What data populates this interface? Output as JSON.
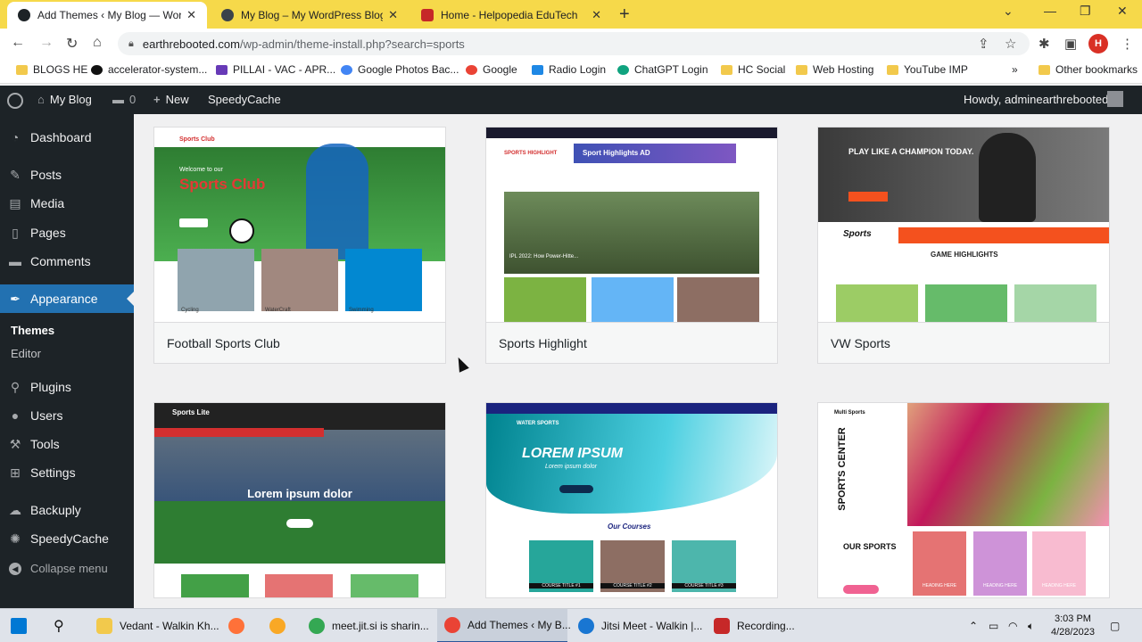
{
  "browser": {
    "tabs": [
      {
        "title": "Add Themes ‹ My Blog — WordPress",
        "active": true
      },
      {
        "title": "My Blog – My WordPress Blog"
      },
      {
        "title": "Home - Helpopedia EduTech"
      }
    ],
    "url": {
      "host": "earthrebooted.com",
      "path": "/wp-admin/theme-install.php?search=sports"
    },
    "profile_initial": "H",
    "bookmarks": [
      "BLOGS HE",
      "accelerator-system...",
      "PILLAI - VAC - APR...",
      "Google Photos Bac...",
      "Google",
      "Radio Login",
      "ChatGPT Login",
      "HC Social",
      "Web Hosting",
      "YouTube IMP",
      "Other bookmarks"
    ]
  },
  "adminbar": {
    "site": "My Blog",
    "comments": "0",
    "new": "New",
    "plugin": "SpeedyCache",
    "howdy": "Howdy, adminearthrebooted"
  },
  "sidebar": {
    "items": [
      {
        "label": "Dashboard",
        "icon": "dashboard-icon"
      },
      {
        "label": "Posts",
        "icon": "pin-icon"
      },
      {
        "label": "Media",
        "icon": "media-icon"
      },
      {
        "label": "Pages",
        "icon": "page-icon"
      },
      {
        "label": "Comments",
        "icon": "comment-icon"
      },
      {
        "label": "Appearance",
        "icon": "brush-icon"
      },
      {
        "label": "Plugins",
        "icon": "plugin-icon"
      },
      {
        "label": "Users",
        "icon": "user-icon"
      },
      {
        "label": "Tools",
        "icon": "wrench-icon"
      },
      {
        "label": "Settings",
        "icon": "settings-icon"
      },
      {
        "label": "Backuply",
        "icon": "cloud-icon"
      },
      {
        "label": "SpeedyCache",
        "icon": "speed-icon"
      }
    ],
    "sub": [
      "Themes",
      "Editor"
    ],
    "collapse": "Collapse menu"
  },
  "themes": [
    {
      "name": "Football Sports Club",
      "shot_brand": "Sports Club",
      "shot_headline": "Sports Club",
      "shot_welcome": "Welcome to our",
      "shot_captions": [
        "Cycling",
        "WaterCraft",
        "Swimming"
      ]
    },
    {
      "name": "Sports Highlight",
      "shot_brand": "SPORTS HIGHLIGHT",
      "shot_headline": "Sport Highlights AD",
      "shot_captions": [
        "IPL 2022: How Power-Hitte..."
      ]
    },
    {
      "name": "VW Sports",
      "shot_brand": "Sports",
      "shot_headline": "PLAY LIKE A CHAMPION TODAY.",
      "shot_captions": [
        "GAME HIGHLIGHTS"
      ]
    },
    {
      "name": "",
      "shot_brand": "Sports Lite",
      "shot_headline": "Lorem ipsum dolor",
      "shot_captions": []
    },
    {
      "name": "",
      "shot_brand": "WATER SPORTS",
      "shot_headline": "LOREM IPSUM",
      "shot_captions": [
        "Lorem ipsum dolor",
        "Our Courses",
        "COURSE TITLE #1",
        "COURSE TITLE #2",
        "COURSE TITLE #3"
      ]
    },
    {
      "name": "",
      "shot_brand": "Multi Sports",
      "shot_headline": "SPORTS CENTER",
      "shot_captions": [
        "OUR SPORTS",
        "HEADING HERE",
        "HEADING HERE",
        "HEADING HERE"
      ]
    }
  ],
  "taskbar": {
    "items": [
      "Vedant - Walkin Kh...",
      "meet.jit.si is sharin...",
      "Add Themes ‹ My B...",
      "Jitsi Meet - Walkin |...",
      "Recording..."
    ],
    "time": "3:03 PM",
    "date": "4/28/2023"
  }
}
